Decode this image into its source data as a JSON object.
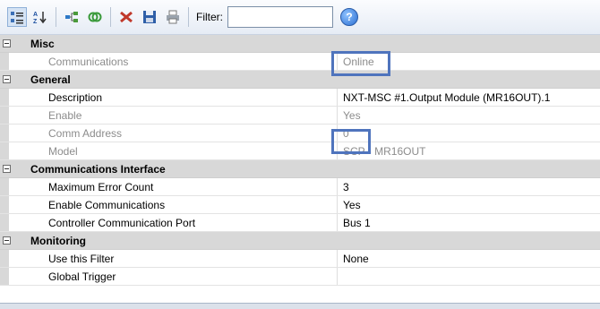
{
  "toolbar": {
    "buttons": [
      {
        "icon": "categorized-icon"
      },
      {
        "icon": "alphabetical-sort-icon"
      },
      {
        "icon": "hierarchy-icon"
      },
      {
        "icon": "link-icon"
      },
      {
        "icon": "delete-icon"
      },
      {
        "icon": "save-icon"
      },
      {
        "icon": "print-icon"
      }
    ],
    "filter_label": "Filter:",
    "filter_value": "",
    "help_icon": "help-icon",
    "help_glyph": "?"
  },
  "categories": [
    {
      "name": "Misc",
      "properties": [
        {
          "name": "Communications",
          "value": "Online",
          "readonly": true
        }
      ]
    },
    {
      "name": "General",
      "properties": [
        {
          "name": "Description",
          "value": "NXT-MSC #1.Output Module (MR16OUT).1",
          "readonly": false
        },
        {
          "name": "Enable",
          "value": "Yes",
          "readonly": true
        },
        {
          "name": "Comm Address",
          "value": "0",
          "readonly": true
        },
        {
          "name": "Model",
          "value": "SCP - MR16OUT",
          "readonly": true
        }
      ]
    },
    {
      "name": "Communications Interface",
      "properties": [
        {
          "name": "Maximum Error Count",
          "value": "3",
          "readonly": false
        },
        {
          "name": "Enable Communications",
          "value": "Yes",
          "readonly": false
        },
        {
          "name": "Controller Communication Port",
          "value": "Bus 1",
          "readonly": false
        }
      ]
    },
    {
      "name": "Monitoring",
      "properties": [
        {
          "name": "Use this Filter",
          "value": "None",
          "readonly": false
        },
        {
          "name": "Global Trigger",
          "value": "",
          "readonly": false
        }
      ]
    }
  ],
  "colors": {
    "highlight": "#4f74bd",
    "category_bg": "#d8d8d8",
    "readonly_text": "#8c8c8c"
  }
}
